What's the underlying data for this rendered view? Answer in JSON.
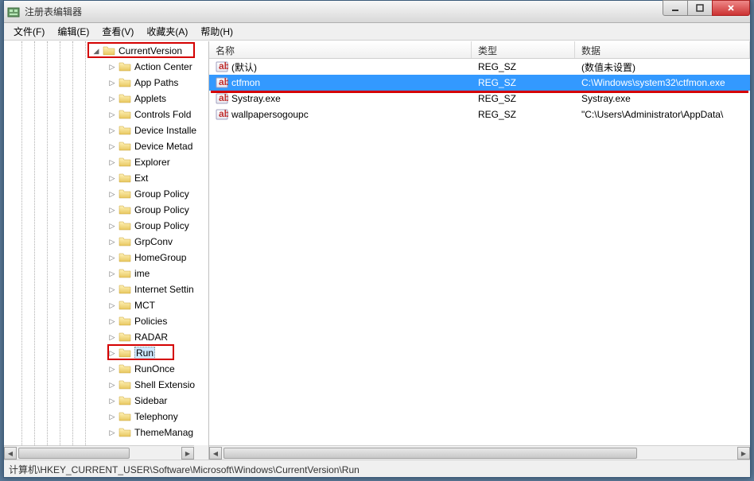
{
  "window": {
    "title": "注册表编辑器"
  },
  "menu": {
    "file": "文件(F)",
    "edit": "编辑(E)",
    "view": "查看(V)",
    "favorites": "收藏夹(A)",
    "help": "帮助(H)"
  },
  "tree": {
    "root_expanded": "CurrentVersion",
    "selected": "Run",
    "items": [
      "Action Center",
      "App Paths",
      "Applets",
      "Controls Fold",
      "Device Installe",
      "Device Metad",
      "Explorer",
      "Ext",
      "Group Policy",
      "Group Policy",
      "Group Policy",
      "GrpConv",
      "HomeGroup",
      "ime",
      "Internet Settin",
      "MCT",
      "Policies",
      "RADAR",
      "Run",
      "RunOnce",
      "Shell Extensio",
      "Sidebar",
      "Telephony",
      "ThemeManag"
    ]
  },
  "list": {
    "headers": {
      "name": "名称",
      "type": "类型",
      "data": "数据"
    },
    "rows": [
      {
        "name": "(默认)",
        "type": "REG_SZ",
        "data": "(数值未设置)",
        "selected": false
      },
      {
        "name": "ctfmon",
        "type": "REG_SZ",
        "data": "C:\\Windows\\system32\\ctfmon.exe",
        "selected": true
      },
      {
        "name": "Systray.exe",
        "type": "REG_SZ",
        "data": "Systray.exe",
        "selected": false
      },
      {
        "name": "wallpapersogoupc",
        "type": "REG_SZ",
        "data": "\"C:\\Users\\Administrator\\AppData\\",
        "selected": false
      }
    ]
  },
  "statusbar": {
    "path": "计算机\\HKEY_CURRENT_USER\\Software\\Microsoft\\Windows\\CurrentVersion\\Run"
  }
}
